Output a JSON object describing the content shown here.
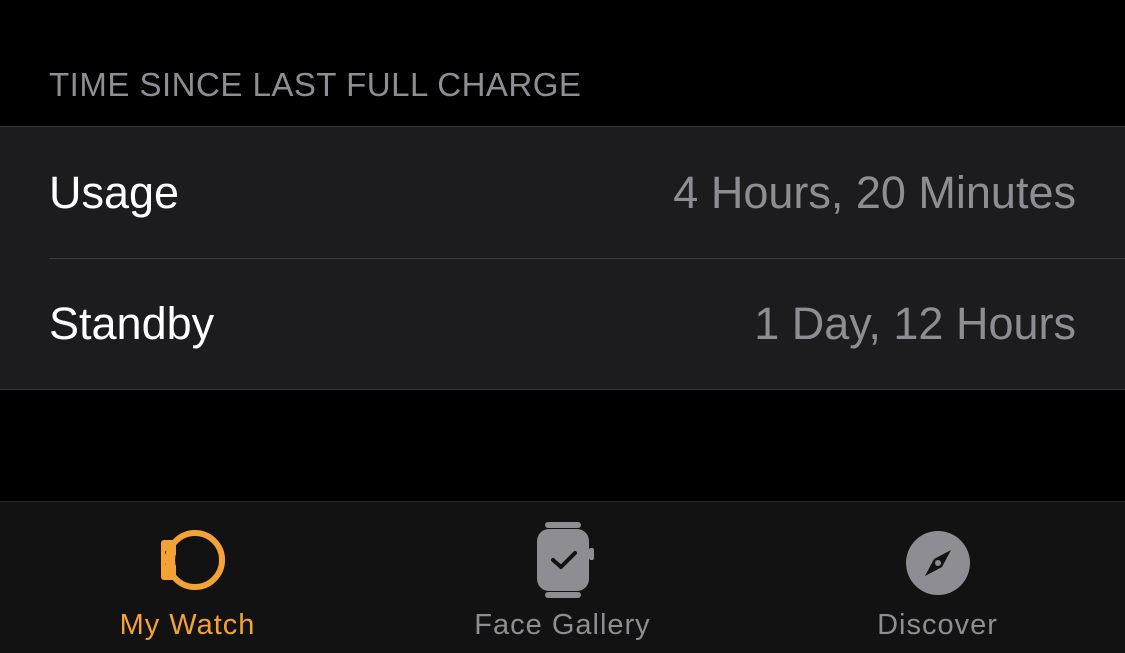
{
  "section": {
    "header": "TIME SINCE LAST FULL CHARGE"
  },
  "rows": [
    {
      "label": "Usage",
      "value": "4 Hours, 20 Minutes"
    },
    {
      "label": "Standby",
      "value": "1 Day, 12 Hours"
    }
  ],
  "tabbar": {
    "tabs": [
      {
        "label": "My Watch",
        "icon": "watch-icon",
        "active": true
      },
      {
        "label": "Face Gallery",
        "icon": "watch-face-icon",
        "active": false
      },
      {
        "label": "Discover",
        "icon": "compass-icon",
        "active": false
      }
    ]
  },
  "colors": {
    "background": "#000000",
    "group_background": "#1c1c1e",
    "secondary_text": "#8d8d93",
    "accent": "#f4a233",
    "tabbar_background": "#121212"
  }
}
